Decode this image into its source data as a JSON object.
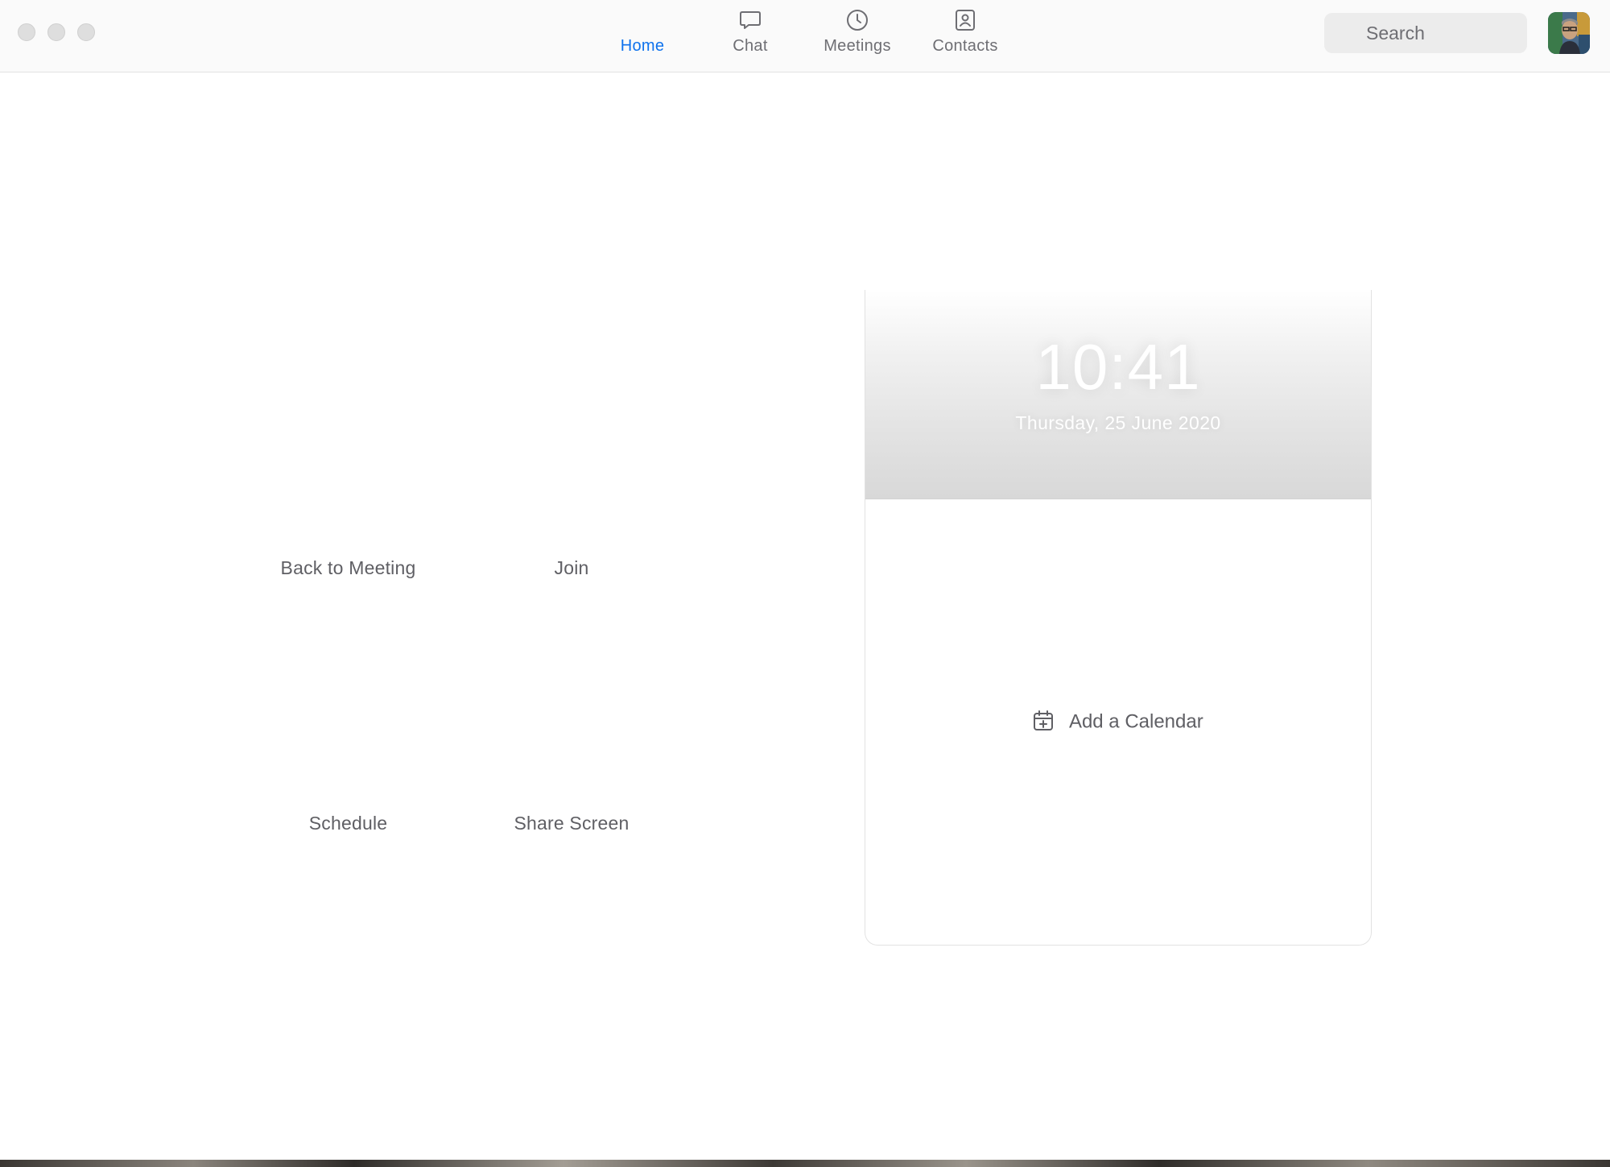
{
  "window": {
    "controls": [
      "close",
      "minimize",
      "zoom"
    ]
  },
  "nav": {
    "tabs": [
      {
        "label": "Home",
        "icon": "home-icon",
        "active": true
      },
      {
        "label": "Chat",
        "icon": "chat-bubble-icon",
        "active": false
      },
      {
        "label": "Meetings",
        "icon": "clock-icon",
        "active": false
      },
      {
        "label": "Contacts",
        "icon": "contact-card-icon",
        "active": false
      }
    ],
    "active_color": "#0e72ed"
  },
  "search": {
    "placeholder": "Search"
  },
  "avatar": {
    "icon": "user-avatar"
  },
  "actions": {
    "back_to_meeting": "Back to Meeting",
    "join": "Join",
    "schedule": "Schedule",
    "share_screen": "Share Screen"
  },
  "calendar_panel": {
    "time": "10:41",
    "date": "Thursday, 25 June 2020",
    "add_calendar_label": "Add a Calendar",
    "add_calendar_icon": "calendar-plus-icon"
  }
}
